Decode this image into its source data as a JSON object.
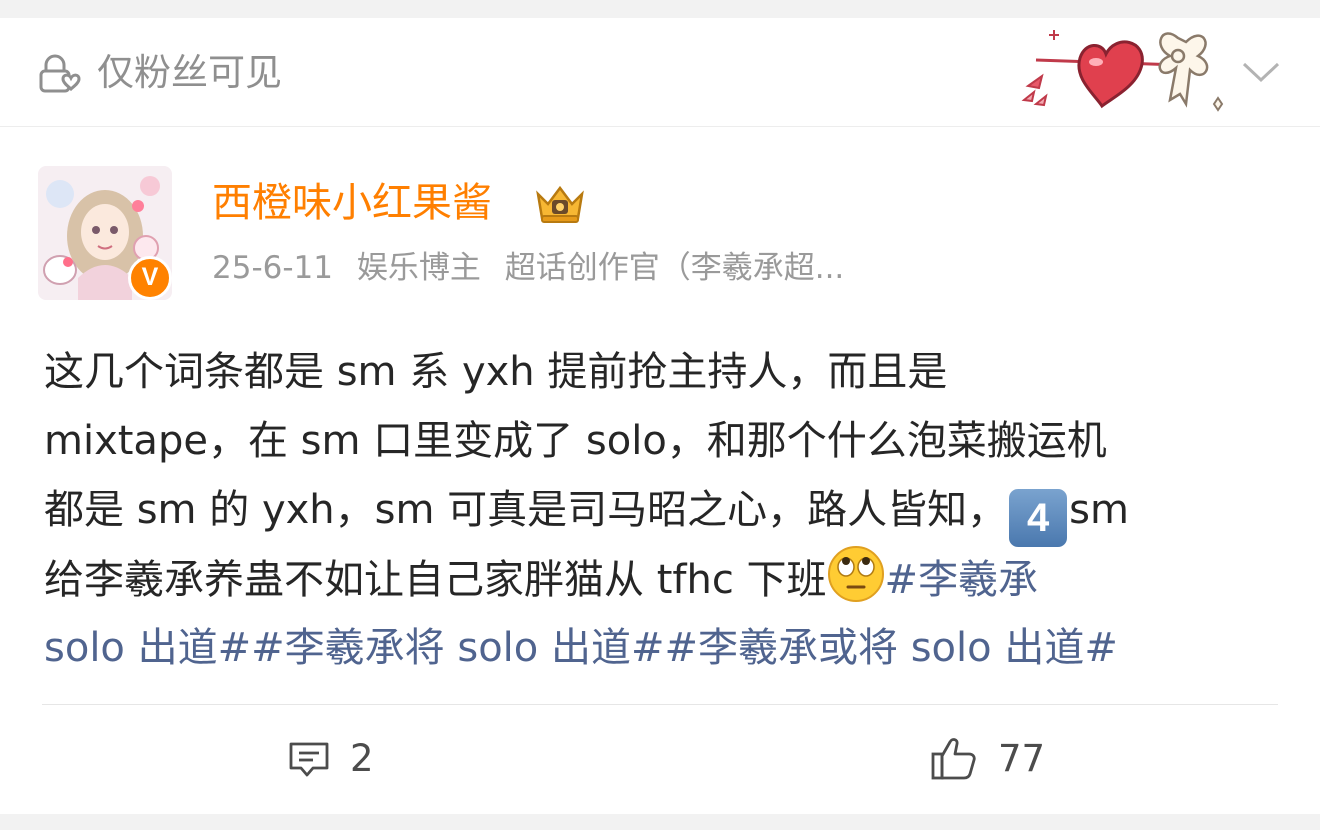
{
  "header": {
    "visibility_label": "仅粉丝可见"
  },
  "author": {
    "name": "西橙味小红果酱",
    "verified_badge": "V",
    "date": "25-6-11",
    "role": "娱乐博主",
    "tag": "超话创作官（李羲承超..."
  },
  "post": {
    "lines": [
      [
        {
          "t": "这几个词条都是 sm 系 yxh 提前抢主持人，而且是"
        }
      ],
      [
        {
          "t": " mixtape，在 sm 口里变成了 solo，和那个什么泡菜搬运机"
        }
      ],
      [
        {
          "t": "都是 sm 的 yxh，sm 可真是司马昭之心，路人皆知，"
        }
      ],
      [
        {
          "t": "给李羲承养蛊不如让自己家胖猫从 tfhc 下班"
        }
      ],
      [
        {
          "t": " solo 出道##李羲承将 solo 出道##李羲承或将 solo 出道#"
        }
      ]
    ],
    "keycap": "4",
    "line3_tail": "sm",
    "line4_tag": "#李羲承"
  },
  "actions": {
    "comment_count": "2",
    "like_count": "77"
  },
  "icons": [
    "lock-heart-icon",
    "heart-arrow-bow-decoration",
    "chevron-down-icon",
    "crown-icon",
    "verified-icon",
    "keycap-4-icon",
    "eye-roll-emoji",
    "comment-icon",
    "thumbs-up-icon"
  ],
  "colors": {
    "username": "#ff7f00",
    "tag_link": "#50648f",
    "verified": "#ff8200",
    "meta_text": "#9a9a9a"
  }
}
